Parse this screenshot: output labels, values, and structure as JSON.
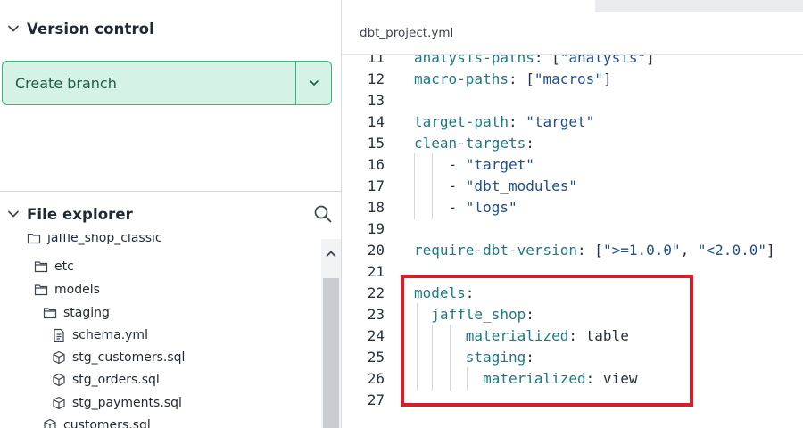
{
  "sidebar": {
    "version_control": {
      "title": "Version control",
      "create_branch_label": "Create branch"
    },
    "file_explorer": {
      "title": "File explorer",
      "cut_item": "jaffle_shop_classic",
      "items": [
        {
          "label": "etc",
          "icon": "folder-icon"
        },
        {
          "label": "models",
          "icon": "folder-open-icon"
        },
        {
          "label": "staging",
          "icon": "folder-open-icon"
        },
        {
          "label": "schema.yml",
          "icon": "file-icon"
        },
        {
          "label": "stg_customers.sql",
          "icon": "cube-icon"
        },
        {
          "label": "stg_orders.sql",
          "icon": "cube-icon"
        },
        {
          "label": "stg_payments.sql",
          "icon": "cube-icon"
        },
        {
          "label": "customers.sql",
          "icon": "cube-icon"
        }
      ]
    }
  },
  "editor": {
    "tab_label": "dbt_project.yml",
    "lines": [
      {
        "n": "11",
        "text": "analysis-paths: [\"analysis\"]"
      },
      {
        "n": "12",
        "text": "macro-paths: [\"macros\"]"
      },
      {
        "n": "13",
        "text": ""
      },
      {
        "n": "14",
        "text": "target-path: \"target\""
      },
      {
        "n": "15",
        "text": "clean-targets:"
      },
      {
        "n": "16",
        "text": "    - \"target\""
      },
      {
        "n": "17",
        "text": "    - \"dbt_modules\""
      },
      {
        "n": "18",
        "text": "    - \"logs\""
      },
      {
        "n": "19",
        "text": ""
      },
      {
        "n": "20",
        "text": "require-dbt-version: [\">=1.0.0\", \"<2.0.0\"]"
      },
      {
        "n": "21",
        "text": ""
      },
      {
        "n": "22",
        "text": "models:"
      },
      {
        "n": "23",
        "text": "  jaffle_shop:"
      },
      {
        "n": "24",
        "text": "      materialized: table"
      },
      {
        "n": "25",
        "text": "      staging:"
      },
      {
        "n": "26",
        "text": "        materialized: view"
      },
      {
        "n": "27",
        "text": ""
      }
    ]
  },
  "colors": {
    "accent_green": "#3fb37f",
    "button_fill": "#d5f3e4",
    "highlight_red": "#d71f2b",
    "yaml_key": "#1b7a83",
    "yaml_string": "#1d4f8f"
  }
}
